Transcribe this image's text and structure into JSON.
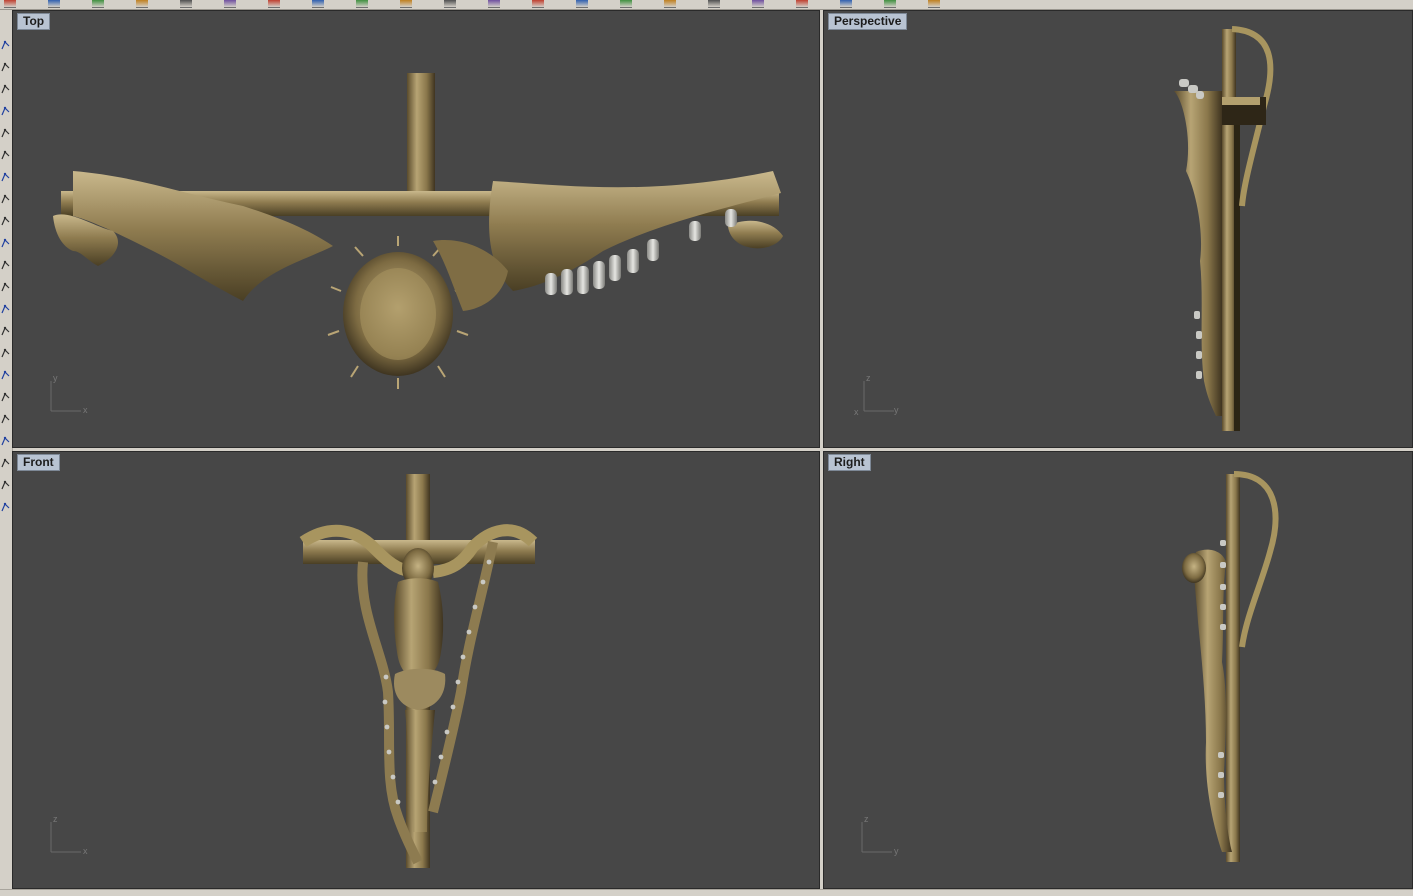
{
  "viewports": {
    "top": {
      "title": "Top",
      "axis_h": "x",
      "axis_v": "y"
    },
    "perspective": {
      "title": "Perspective",
      "axis_h": "y",
      "axis_v": "z",
      "axis_third": "x"
    },
    "front": {
      "title": "Front",
      "axis_h": "x",
      "axis_v": "z"
    },
    "right": {
      "title": "Right",
      "axis_h": "y",
      "axis_v": "z"
    }
  },
  "colors": {
    "viewport_bg": "#474747",
    "model_gold": "#9c8a5f",
    "model_shadow": "#4e4226",
    "gem_silver": "#c9c9c4",
    "title_tab": "#b8c3d2"
  },
  "toolbar_icons": [
    "new-file-icon",
    "open-file-icon",
    "save-icon",
    "print-icon",
    "cut-icon",
    "copy-icon",
    "paste-icon",
    "undo-icon",
    "redo-icon",
    "pan-icon",
    "rotate-icon",
    "zoom-icon",
    "zoom-window-icon",
    "zoom-extents-icon",
    "select-icon",
    "grid-icon",
    "osnap-icon",
    "render-icon",
    "shade-icon",
    "material-icon",
    "light-icon",
    "help-icon"
  ],
  "side_icons": [
    "point-icon",
    "polyline-icon",
    "curve-icon",
    "arc-icon",
    "circle-icon",
    "rectangle-icon",
    "polygon-icon",
    "ellipse-icon",
    "surface-icon",
    "solid-icon",
    "sphere-icon",
    "cylinder-icon",
    "box-icon",
    "extrude-icon",
    "loft-icon",
    "dot-icon",
    "move-icon",
    "transform-icon",
    "edit-points-icon",
    "dimension-icon",
    "layer-icon",
    "text-icon"
  ]
}
